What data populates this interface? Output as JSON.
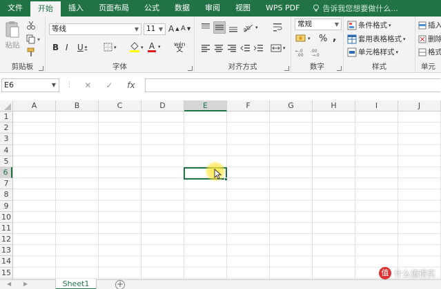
{
  "tabs": [
    {
      "label": "文件",
      "active": false
    },
    {
      "label": "开始",
      "active": true
    },
    {
      "label": "插入",
      "active": false
    },
    {
      "label": "页面布局",
      "active": false
    },
    {
      "label": "公式",
      "active": false
    },
    {
      "label": "数据",
      "active": false
    },
    {
      "label": "审阅",
      "active": false
    },
    {
      "label": "视图",
      "active": false
    },
    {
      "label": "WPS PDF",
      "active": false
    }
  ],
  "tellme": {
    "text": "告诉我您想要做什么..."
  },
  "ribbon": {
    "clipboard": {
      "label": "剪贴板",
      "paste_label": "粘贴"
    },
    "font": {
      "label": "字体",
      "font_name": "等线",
      "font_size": "11",
      "grow": "A",
      "shrink": "A",
      "bold": "B",
      "italic": "I",
      "underline": "U",
      "font_color_letter": "A",
      "phonetic": "wén"
    },
    "alignment": {
      "label": "对齐方式"
    },
    "number": {
      "label": "数字",
      "format": "常规",
      "percent": "%",
      "comma": ","
    },
    "styles": {
      "label": "样式",
      "conditional": "条件格式",
      "table": "套用表格格式",
      "cell_styles": "单元格样式"
    },
    "cells": {
      "label": "单元",
      "insert": "插入",
      "delete": "删除",
      "format": "格式"
    }
  },
  "formula_bar": {
    "name_box": "E6",
    "fx": "fx",
    "content": ""
  },
  "columns": [
    "A",
    "B",
    "C",
    "D",
    "E",
    "F",
    "G",
    "H",
    "I",
    "J"
  ],
  "selected_column": "E",
  "rows": [
    "1",
    "2",
    "3",
    "4",
    "5",
    "6",
    "7",
    "8",
    "9",
    "10",
    "11",
    "12",
    "13",
    "14",
    "15"
  ],
  "selected_row": "6",
  "sheets": [
    {
      "name": "Sheet1",
      "active": true
    }
  ],
  "watermark": {
    "text": "什么值得买",
    "icon": "值"
  },
  "accent_color": "#217346"
}
